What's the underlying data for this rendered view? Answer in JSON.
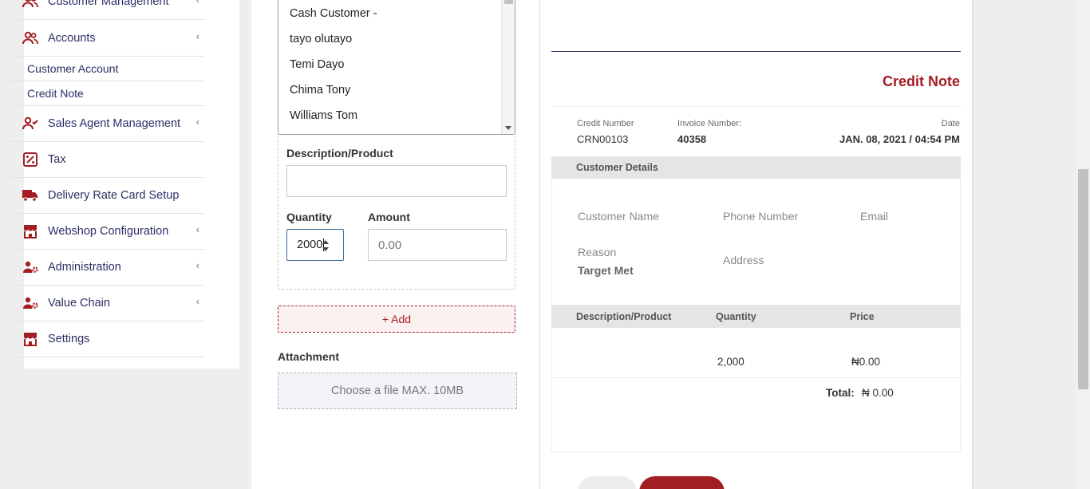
{
  "sidebar": {
    "items": [
      {
        "label": "Customer Management",
        "icon": "users-icon",
        "has_chevron": true
      },
      {
        "label": "Accounts",
        "icon": "users-icon",
        "has_chevron": true
      },
      {
        "label": "Sales Agent Management",
        "icon": "user-check-icon",
        "has_chevron": true
      },
      {
        "label": "Tax",
        "icon": "percent-icon",
        "has_chevron": false
      },
      {
        "label": "Delivery Rate Card Setup",
        "icon": "truck-icon",
        "has_chevron": false
      },
      {
        "label": "Webshop Configuration",
        "icon": "store-icon",
        "has_chevron": true
      },
      {
        "label": "Administration",
        "icon": "user-gear-icon",
        "has_chevron": true
      },
      {
        "label": "Value Chain",
        "icon": "user-gear-icon",
        "has_chevron": true
      },
      {
        "label": "Settings",
        "icon": "store-icon",
        "has_chevron": false
      }
    ],
    "sub_items": [
      "Customer Account",
      "Credit Note"
    ],
    "chevron": "‹",
    "accent_color": "#a31d24",
    "text_color": "#2c2f66"
  },
  "form": {
    "customer_options": [
      "Cash Customer -",
      "tayo olutayo",
      "Temi Dayo",
      "Chima Tony",
      "Williams Tom"
    ],
    "description_label": "Description/Product",
    "description_value": "",
    "quantity_label": "Quantity",
    "quantity_value": "2000",
    "amount_label": "Amount",
    "amount_placeholder": "0.00",
    "add_button": "+ Add",
    "attachment_label": "Attachment",
    "attachment_prompt": "Choose a file MAX. 10MB"
  },
  "preview": {
    "title": "Credit Note",
    "credit_number_label": "Credit Number",
    "credit_number": "CRN00103",
    "invoice_number_label": "Invoice Number:",
    "invoice_number": "40358",
    "date_label": "Date",
    "date": "JAN. 08, 2021 / 04:54 PM",
    "customer_details_header": "Customer Details",
    "customer_name_label": "Customer Name",
    "phone_label": "Phone Number",
    "email_label": "Email",
    "reason_label": "Reason",
    "reason_value": "Target Met",
    "address_label": "Address",
    "table_headers": [
      "Description/Product",
      "Quantity",
      "Price"
    ],
    "rows": [
      {
        "description": "",
        "quantity": "2,000",
        "price": "₦0.00"
      }
    ],
    "total_label": "Total:",
    "total_value": "₦ 0.00",
    "title_color": "#a31d24"
  }
}
